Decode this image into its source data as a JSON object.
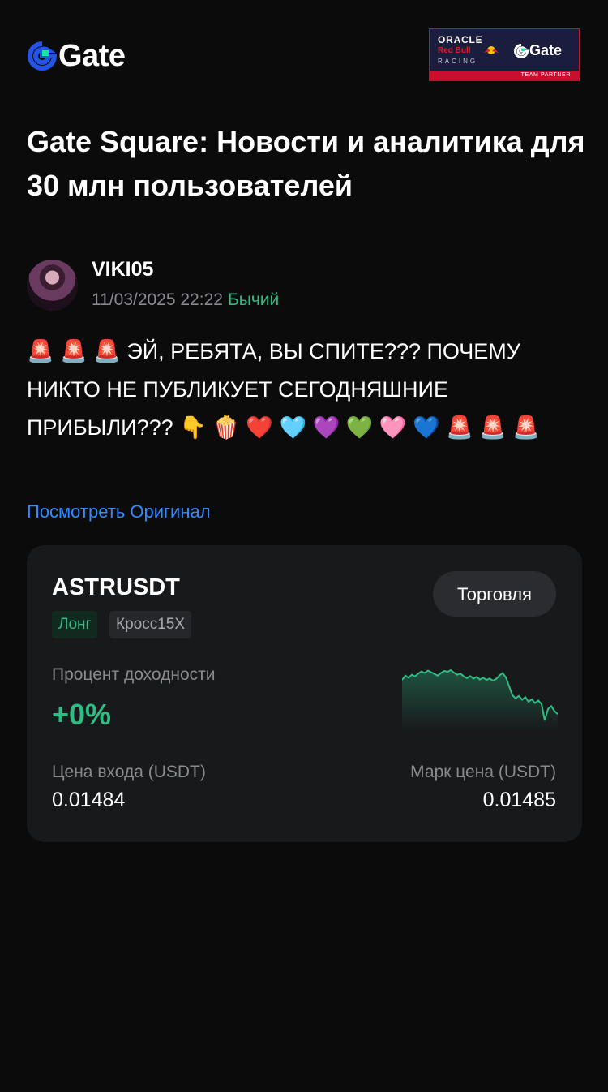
{
  "brand": {
    "logo_text": "Gate",
    "partner": {
      "oracle": "ORACLE",
      "redbull": "Red Bull",
      "racing": "RACING",
      "gate": "Gate",
      "strip": "TEAM PARTNER"
    }
  },
  "hero": {
    "title": "Gate Square: Новости и аналитика для 30 млн пользователей"
  },
  "post": {
    "author": "VIKI05",
    "timestamp": "11/03/2025 22:22",
    "sentiment": "Бычий",
    "text": "🚨 🚨 🚨 ЭЙ, РЕБЯТА, ВЫ СПИТЕ??? ПОЧЕМУ НИКТО НЕ ПУБЛИКУЕТ СЕГОДНЯШНИЕ ПРИБЫЛИ??? 👇 🍿 ❤️ 🩵 💜 💚 🩷 💙 🚨 🚨 🚨",
    "view_original": "Посмотреть Оригинал"
  },
  "position_card": {
    "pair": "ASTRUSDT",
    "trade_button": "Торговля",
    "tag_side": "Лонг",
    "tag_margin": "Кросс15X",
    "yield_label": "Процент доходности",
    "yield_value": "+0%",
    "entry_label": "Цена входа (USDT)",
    "entry_value": "0.01484",
    "mark_label": "Марк цена (USDT)",
    "mark_value": "0.01485",
    "sparkline": {
      "color": "#2ebd85",
      "values": [
        62,
        63,
        62.5,
        63.2,
        62.8,
        63.5,
        64,
        63.6,
        64.2,
        63.8,
        63.4,
        63,
        63.6,
        64.1,
        63.9,
        64.3,
        63.7,
        63.2,
        63.5,
        62.8,
        62.4,
        62.9,
        62.3,
        62.7,
        62.1,
        62.5,
        62.0,
        62.3,
        61.8,
        62.2,
        63.0,
        63.6,
        62.6,
        60.5,
        58.4,
        57.6,
        58.2,
        57.3,
        57.9,
        56.8,
        57.4,
        56.5,
        57.1,
        56.3,
        52.4,
        55.1,
        55.8,
        54.6,
        53.9
      ]
    }
  }
}
